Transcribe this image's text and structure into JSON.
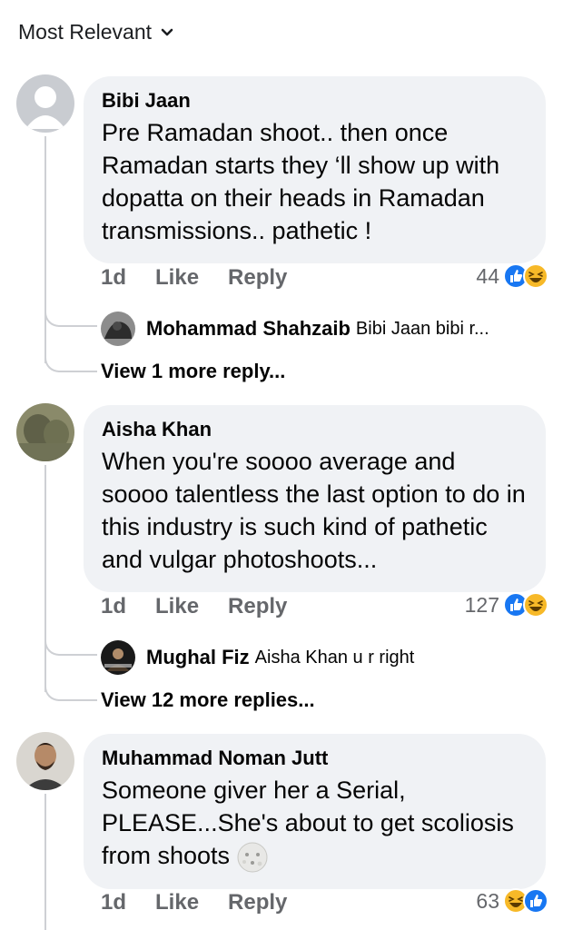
{
  "sort": {
    "label": "Most Relevant",
    "icon": "chevron-down-icon"
  },
  "comments": [
    {
      "author": "Bibi Jaan",
      "text": "Pre Ramadan shoot.. then once Ramadan starts they ‘ll show up with dopatta on their heads in Ramadan transmissions.. pathetic !",
      "time": "1d",
      "like": "Like",
      "reply": "Reply",
      "reaction_count": "44",
      "reactions": [
        "like",
        "haha"
      ],
      "preview_reply": {
        "author": "Mohammad Shahzaib",
        "text": "Bibi Jaan bibi r..."
      },
      "more_replies": "View 1 more reply..."
    },
    {
      "author": "Aisha Khan",
      "text": "When you're soooo average and soooo talentless the last option to do in this industry is such kind of pathetic and vulgar photoshoots...",
      "time": "1d",
      "like": "Like",
      "reply": "Reply",
      "reaction_count": "127",
      "reactions": [
        "like",
        "haha"
      ],
      "preview_reply": {
        "author": "Mughal Fiz",
        "text": "Aisha Khan u r right"
      },
      "more_replies": "View 12 more replies..."
    },
    {
      "author": "Muhammad Noman Jutt",
      "text": "Someone giver her a Serial, PLEASE...She's about to get scoliosis from shoots",
      "text_emoji": "moon-face-emoji",
      "time": "1d",
      "like": "Like",
      "reply": "Reply",
      "reaction_count": "63",
      "reactions": [
        "haha",
        "like"
      ]
    }
  ],
  "colors": {
    "bubble": "#f0f2f5",
    "meta": "#65676b",
    "like_blue": "#1877f2",
    "haha_yellow": "#f7b928"
  }
}
